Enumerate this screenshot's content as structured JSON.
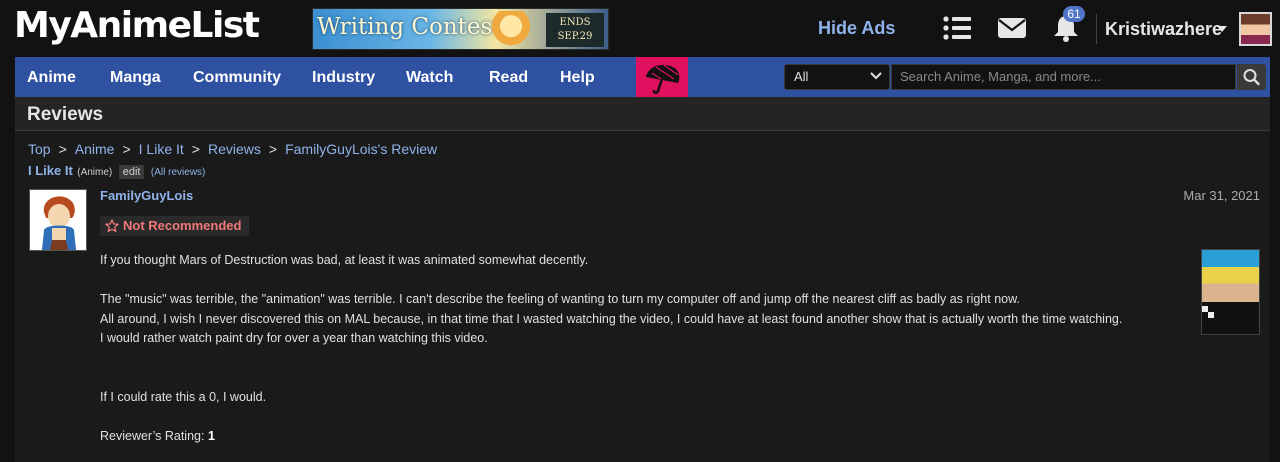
{
  "header": {
    "logo": "MyAnimeList",
    "banner": {
      "title": "Writing Contest",
      "badge_line1": "ENDS",
      "badge_line2": "SEP.29"
    },
    "hide_ads": "Hide Ads",
    "notification_count": "61",
    "username": "Kristiwazhere",
    "icons": [
      "list-icon",
      "mail-icon",
      "bell-icon",
      "caret-down-icon"
    ]
  },
  "nav": {
    "items": [
      "Anime",
      "Manga",
      "Community",
      "Industry",
      "Watch",
      "Read",
      "Help"
    ],
    "search": {
      "category": "All",
      "placeholder": "Search Anime, Manga, and more..."
    }
  },
  "page": {
    "title": "Reviews"
  },
  "breadcrumb": [
    "Top",
    "Anime",
    "I Like It",
    "Reviews",
    "FamilyGuyLois's Review"
  ],
  "subline": {
    "title": "I Like It",
    "type": "(Anime)",
    "edit": "edit",
    "all_reviews": "(All reviews)"
  },
  "review": {
    "author": "FamilyGuyLois",
    "date": "Mar 31, 2021",
    "tag": "Not Recommended",
    "paragraphs": [
      "If you thought Mars of Destruction was bad, at least it was animated somewhat decently.",
      "The \"music\" was terrible, the \"animation\" was terrible. I can't describe the feeling of wanting to turn my computer off and jump off the nearest cliff as badly as right now.",
      "All around, I wish I never discovered this on MAL because, in that time that I wasted watching the video, I could have at least found another show that is actually worth the time watching.",
      "I would rather watch paint dry for over a year than watching this video.",
      "If I could rate this a 0, I would."
    ],
    "rating_label": "Reviewer’s Rating:",
    "rating_value": "1"
  },
  "colors": {
    "nav_bg": "#2e51a2",
    "link": "#8fb3ea",
    "not_recommended": "#f07878",
    "badge": "#4f74c8",
    "promo": "#e0115f"
  }
}
